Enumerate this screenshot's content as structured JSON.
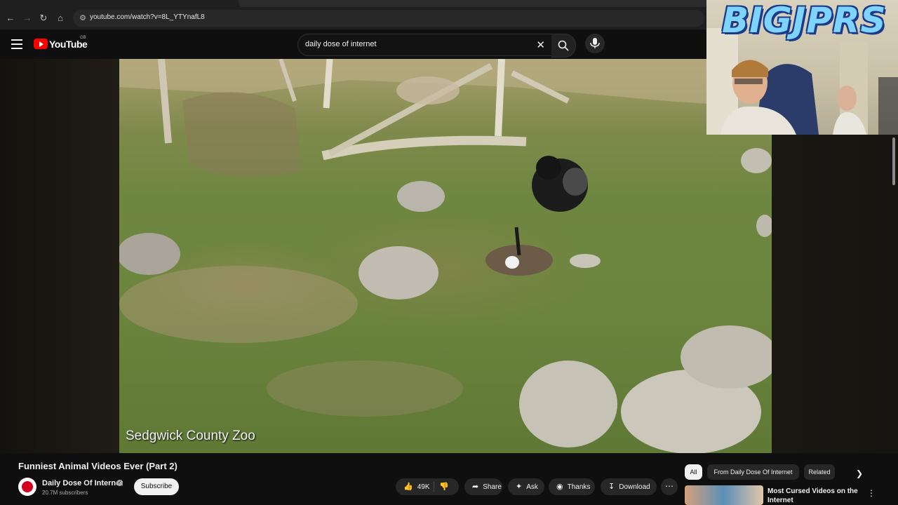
{
  "browser": {
    "url": "youtube.com/watch?v=8L_YTYnafL8",
    "back_icon": "arrow-left-icon",
    "forward_icon": "arrow-right-icon",
    "reload_icon": "reload-icon",
    "home_icon": "home-icon"
  },
  "header": {
    "logo_text": "YouTube",
    "logo_country": "GB",
    "search_query": "daily dose of internet",
    "brand_color": "#ff0000"
  },
  "video": {
    "caption": "Sedgwick County Zoo"
  },
  "webcam": {
    "banner": "BIGJPRS"
  },
  "details": {
    "title": "Funniest Animal Videos Ever (Part 2)",
    "channel": "Daily Dose Of Internet",
    "subscribers": "20.7M subscribers",
    "subscribe_label": "Subscribe",
    "likes": "49K",
    "share_label": "Share",
    "ask_label": "Ask",
    "thanks_label": "Thanks",
    "download_label": "Download"
  },
  "sidebar": {
    "chips": [
      "All",
      "From Daily Dose Of Internet",
      "Related"
    ],
    "recommended_title": "Most Cursed Videos on the Internet"
  }
}
